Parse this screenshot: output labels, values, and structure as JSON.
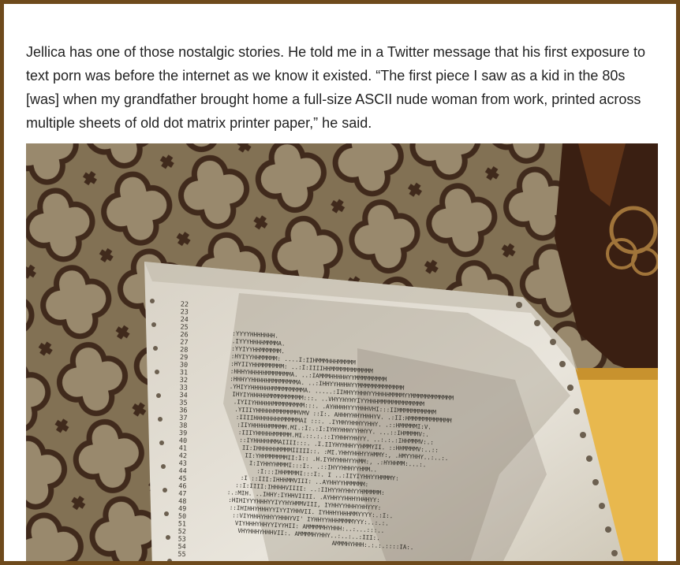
{
  "article": {
    "paragraph": "Jellica has one of those nostalgic stories. He told me in a Twitter message that his first exposure to text porn was before the internet as we know it existed. “The first piece I saw as a kid in the 80s [was] when my grandfather brought home a full-size ASCII nude woman from work, printed across multiple sheets of old dot matrix printer paper,” he said."
  },
  "photo": {
    "subject": "dot-matrix-printout-of-ascii-art-on-tiled-floor",
    "line_numbers": [
      "22",
      "23",
      "24",
      "25",
      "26",
      "27",
      "28",
      "29",
      "30",
      "31",
      "32",
      "33",
      "34",
      "35",
      "36",
      "37",
      "38",
      "39",
      "40",
      "41",
      "42",
      "43",
      "44",
      "45",
      "46",
      "47",
      "48",
      "49",
      "50",
      "51",
      "52",
      "53",
      "54",
      "55"
    ],
    "ascii_rows": [
      ":YYYYHHHHHHH.",
      ".IYYYHHHHMMMMA.",
      ":YYIYYHHMMMMMM.",
      ":HYIYYHHMMMMM: ....I:IIHMMMHHHMMMMM",
      ":HYIIYHHMMMMMMM: ..:I:IIIIHHMMMMMMMMMMMM",
      ":HHHYHHHHHMMMMMMMA. ..:IAMMMHHHHHYYMMMMMMMMM",
      ":HHHYYHHHHHMMMMMMMMA. ..:IHHYYHHHHYYMMMMMMMMMMMMM",
      ".YHIYYHHHHHHMMMMMMMMMA. .....:IIHHYYHHHYYHHHHMMMMYYMMMMMMMMMMMM",
      "IHYIYHHHHHMMMMMMMMMM:::. ..VHYYHYHYIYYHHHMMMMMMMMMMMMM",
      ".IYIIYHHHHHMMMMMMMMM:::. .AYHHHHYYYHHHVHI:::IIMMMMMMMMMMM",
      ".YIIIYHHHHHMMMMMMMVMV ::I:. AHHHYHHYHHHYV. .:II:HMMMMMMMMMMMM",
      ":IIIIHHHHHHHHMMMMMAI :::. .IYHHYHHHYYHHY. .::HMMMMMI:V.",
      ":IIYHHHHHMMMMM.MI.:I:.:I:IYHYHHHYYHHYY. ...::IHMMMMV:.",
      ":IIIYHHHHHMMMMM.MI.::.:.::IYHHHYHHYY. ..:.:.:IHHMMMV:.:",
      "::IYHHHHHMMAIIII:::. .I.IIYHYHHHYYHMMYII. ::HHMMMMV:..::",
      "II:IHHHHHHMMMMIIIII::. :MI.YHHYHHHYYHMMY:, .HMYYHHY..:..:.",
      "II:YHHMMMMMMII:I:: .H.IYHYHHHYYHMM:, .:HYHHMM:...:.",
      "I:IYHHYHMMMI:::I:. .::IHYYHHHYYHMM..",
      ":I:::IHHMMMMI:::I:. I ..:IIYIYHHYYHMMMY:",
      ":I ::III:IHHHMMVIII: ..AYHHYYHMMMMM:",
      "::I:IIII:IHHHHVIIII: ..:IIHYYHYHHYYHMMMMM:",
      ":.:MIH. ..IHHY:IYHHVIIII. .AYHHYYHHHYHHHYY:",
      ":HIHIYYYHHHYYIYYHYHMMVIII, IYHHYYHHHYHHYYY:",
      "::IHIHHYHHHYYIYYIYHHVII. IYHHHYHHHMMYYYY:.:I:.",
      "::VIYHHHYHHYYHHHYVI' IYHHYYHHHMMMMYYY:..:.:.",
      "VIYHHHYHHYYIYYHII: AMMMMMHYHHH:..:...:::..",
      "VHYHHHYHHHVII:. AMMMMHYHHY..:..:..:III:.",
      "AMMMHYHHH:.:.:.::::IA:."
    ]
  }
}
